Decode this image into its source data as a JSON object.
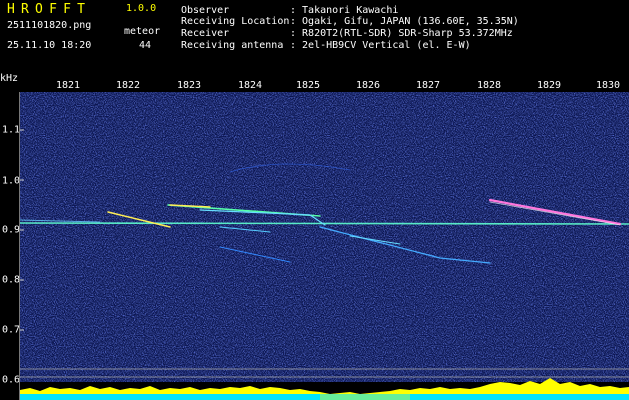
{
  "app": {
    "title": "HROFFT",
    "version": "1.0.0",
    "file_name": "2511101820.png",
    "datetime": "25.11.10 18:20",
    "meteor_label": "meteor",
    "meteor_count": "44"
  },
  "info": [
    {
      "label": "Observer",
      "value": ": Takanori Kawachi"
    },
    {
      "label": "Receiving Location",
      "value": ": Ogaki, Gifu, JAPAN (136.60E, 35.35N)"
    },
    {
      "label": "Receiver",
      "value": ": R820T2(RTL-SDR) SDR-Sharp 53.372MHz"
    },
    {
      "label": "Receiving antenna",
      "value": ": 2el-HB9CV Vertical (el. E-W)"
    }
  ],
  "axis": {
    "y_unit": "kHz",
    "x_ticks": [
      "1821",
      "1822",
      "1823",
      "1824",
      "1825",
      "1826",
      "1827",
      "1828",
      "1829",
      "1830"
    ],
    "y_ticks": [
      "1.1",
      "1.0",
      "0.9",
      "0.8",
      "0.7",
      "0.6"
    ]
  },
  "colors": {
    "title": "#ffff00",
    "text": "#ffffff",
    "background_noise": "#0d1a5e",
    "carrier": "#66ffcc",
    "level_fill": "#ffff00",
    "level_base": "#00e5ff"
  }
}
